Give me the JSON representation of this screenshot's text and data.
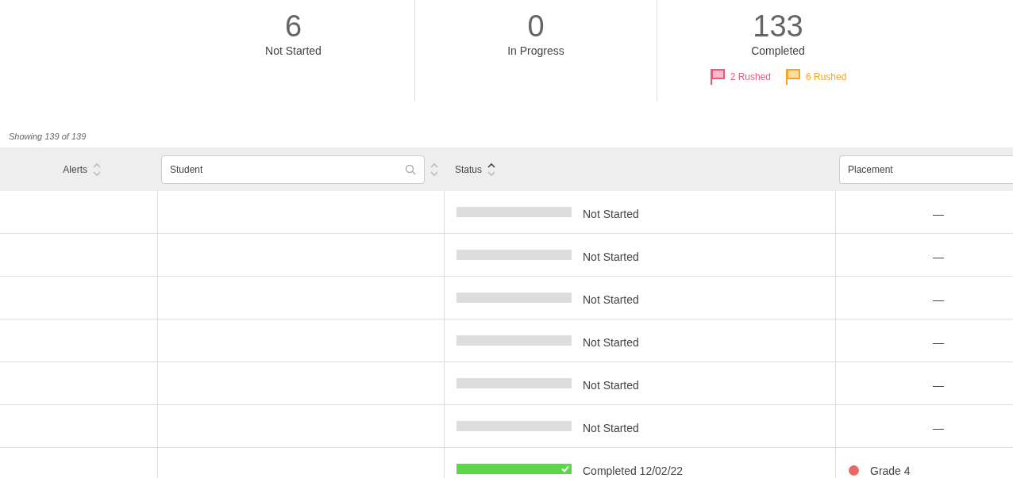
{
  "summary": [
    {
      "count": "6",
      "label": "Not Started"
    },
    {
      "count": "0",
      "label": "In Progress"
    },
    {
      "count": "133",
      "label": "Completed",
      "flags": [
        {
          "text": "2 Rushed",
          "color": "#f0587a"
        },
        {
          "text": "6 Rushed",
          "color": "#f5a623"
        }
      ]
    }
  ],
  "showing": "Showing 139 of 139",
  "columns": [
    {
      "kind": "label",
      "label": "Alerts",
      "sorted": false
    },
    {
      "kind": "search",
      "placeholder": "Student",
      "sorted": false
    },
    {
      "kind": "label",
      "label": "Status",
      "sorted": true
    },
    {
      "kind": "field",
      "placeholder": "Placement"
    }
  ],
  "rows": [
    {
      "level": 0,
      "status": "Not Started",
      "done": false,
      "placement": "—"
    },
    {
      "level": 0,
      "status": "Not Started",
      "done": false,
      "placement": "—"
    },
    {
      "level": 0,
      "status": "Not Started",
      "done": false,
      "placement": "—"
    },
    {
      "level": 0,
      "status": "Not Started",
      "done": false,
      "placement": "—"
    },
    {
      "level": 0,
      "status": "Not Started",
      "done": false,
      "placement": "—"
    },
    {
      "level": 0,
      "status": "Not Started",
      "done": false,
      "placement": "—"
    },
    {
      "level": 1,
      "status": "Completed 12/02/22",
      "done": true,
      "placement": "Grade 4",
      "color": "#e86a67"
    }
  ]
}
